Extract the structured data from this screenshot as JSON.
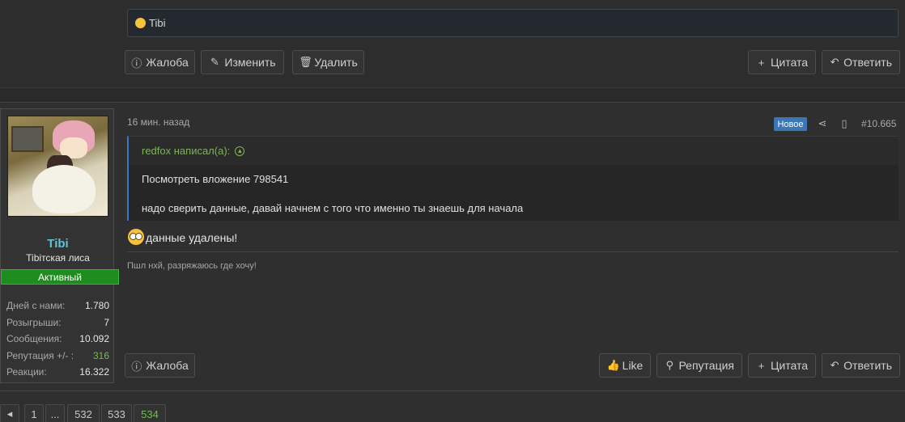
{
  "prev_post": {
    "signature_text": "Tibi",
    "buttons": {
      "report": "Жалоба",
      "edit": "Изменить",
      "delete": "Удалить",
      "quote": "Цитата",
      "reply": "Ответить"
    }
  },
  "user": {
    "name": "Tibi",
    "title": "Tibiтская лиса",
    "badge": "Активный",
    "stats": [
      {
        "label": "Дней с нами:",
        "value": "1.780"
      },
      {
        "label": "Розыгрыши:",
        "value": "7"
      },
      {
        "label": "Сообщения:",
        "value": "10.092"
      },
      {
        "label": "Репутация +/- :",
        "value": "316"
      },
      {
        "label": "Реакции:",
        "value": "16.322"
      }
    ]
  },
  "post": {
    "time": "16 мин. назад",
    "new_badge": "Новое",
    "number": "#10.665",
    "quote": {
      "author": "redfox написал(а):",
      "line1": "Посмотреть вложение 798541",
      "line2": "надо сверить данные, давай начнем с того что именно ты знаешь для начала"
    },
    "message": "данные удалены!",
    "signature": "Пшл нхй, разряжаюсь где хочу!",
    "buttons": {
      "report": "Жалоба",
      "like": "Like",
      "reputation": "Репутация",
      "quote": "Цитата",
      "reply": "Ответить"
    }
  },
  "pagination": {
    "prev": "◂",
    "pages": [
      "1",
      "...",
      "532",
      "533",
      "534"
    ]
  },
  "colors": {
    "accent_blue": "#3d76b5",
    "accent_green": "#6fbf4a",
    "username": "#5fc3d9",
    "badge_green": "#1f8c1f"
  }
}
